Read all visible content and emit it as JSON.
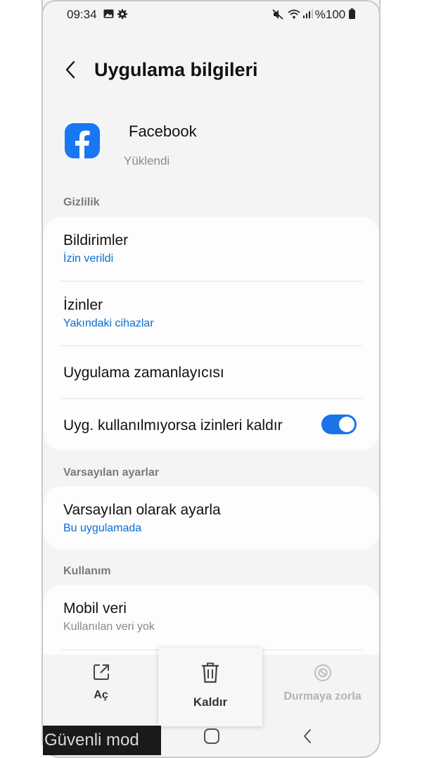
{
  "status_bar": {
    "time": "09:34",
    "battery": "%100",
    "icons": [
      "gallery-icon",
      "settings-gear-icon",
      "mute-icon",
      "wifi-icon",
      "signal-icon",
      "battery-icon"
    ]
  },
  "header": {
    "title": "Uygulama bilgileri",
    "back_icon": "chevron-left-icon"
  },
  "app": {
    "name": "Facebook",
    "status": "Yüklendi",
    "icon": "facebook-icon",
    "brand_color": "#1877f2"
  },
  "sections": {
    "privacy": {
      "label": "Gizlilik",
      "notifications": {
        "title": "Bildirimler",
        "sub": "İzin verildi"
      },
      "permissions": {
        "title": "İzinler",
        "sub": "Yakındaki cihazlar"
      },
      "scheduler": {
        "title": "Uygulama zamanlayıcısı"
      },
      "remove_permissions": {
        "title": "Uyg. kullanılmıyorsa izinleri kaldır",
        "enabled": true
      }
    },
    "defaults": {
      "label": "Varsayılan ayarlar",
      "set_default": {
        "title": "Varsayılan olarak ayarla",
        "sub": "Bu uygulamada"
      }
    },
    "usage": {
      "label": "Kullanım",
      "mobile_data": {
        "title": "Mobil veri",
        "sub": "Kullanılan veri yok"
      }
    }
  },
  "actions": {
    "open": "Aç",
    "uninstall": "Kaldır",
    "force_stop": "Durmaya zorla"
  },
  "safe_mode": "Güvenli mod",
  "colors": {
    "accent": "#0a6dd4",
    "toggle_on": "#1a73e8",
    "background": "#f4f4f4"
  }
}
